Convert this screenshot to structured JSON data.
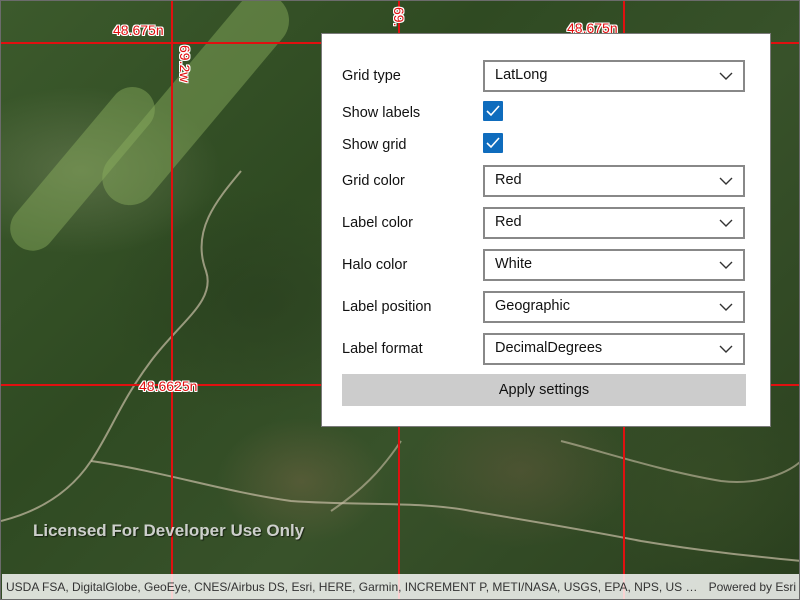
{
  "map": {
    "grid_color": "#e01010",
    "labels": {
      "top_left_lat": "48.675n",
      "top_right_lat": "48.675n",
      "left_lon": "69.2w",
      "top_lon_partial": "69.",
      "mid_lat": "48.6625n"
    },
    "watermark": "Licensed For Developer Use Only"
  },
  "attribution": {
    "text": "USDA FSA, DigitalGlobe, GeoEye, CNES/Airbus DS, Esri, HERE, Garmin, INCREMENT P, METI/NASA, USGS, EPA, NPS, US Census Bure...",
    "powered_by": "Powered by Esri"
  },
  "settings": {
    "grid_type": {
      "label": "Grid type",
      "value": "LatLong"
    },
    "show_labels": {
      "label": "Show labels",
      "checked": true
    },
    "show_grid": {
      "label": "Show grid",
      "checked": true
    },
    "grid_color": {
      "label": "Grid color",
      "value": "Red"
    },
    "label_color": {
      "label": "Label color",
      "value": "Red"
    },
    "halo_color": {
      "label": "Halo color",
      "value": "White"
    },
    "label_position": {
      "label": "Label position",
      "value": "Geographic"
    },
    "label_format": {
      "label": "Label format",
      "value": "DecimalDegrees"
    },
    "apply_label": "Apply settings",
    "accent_color": "#0f6cbd"
  }
}
